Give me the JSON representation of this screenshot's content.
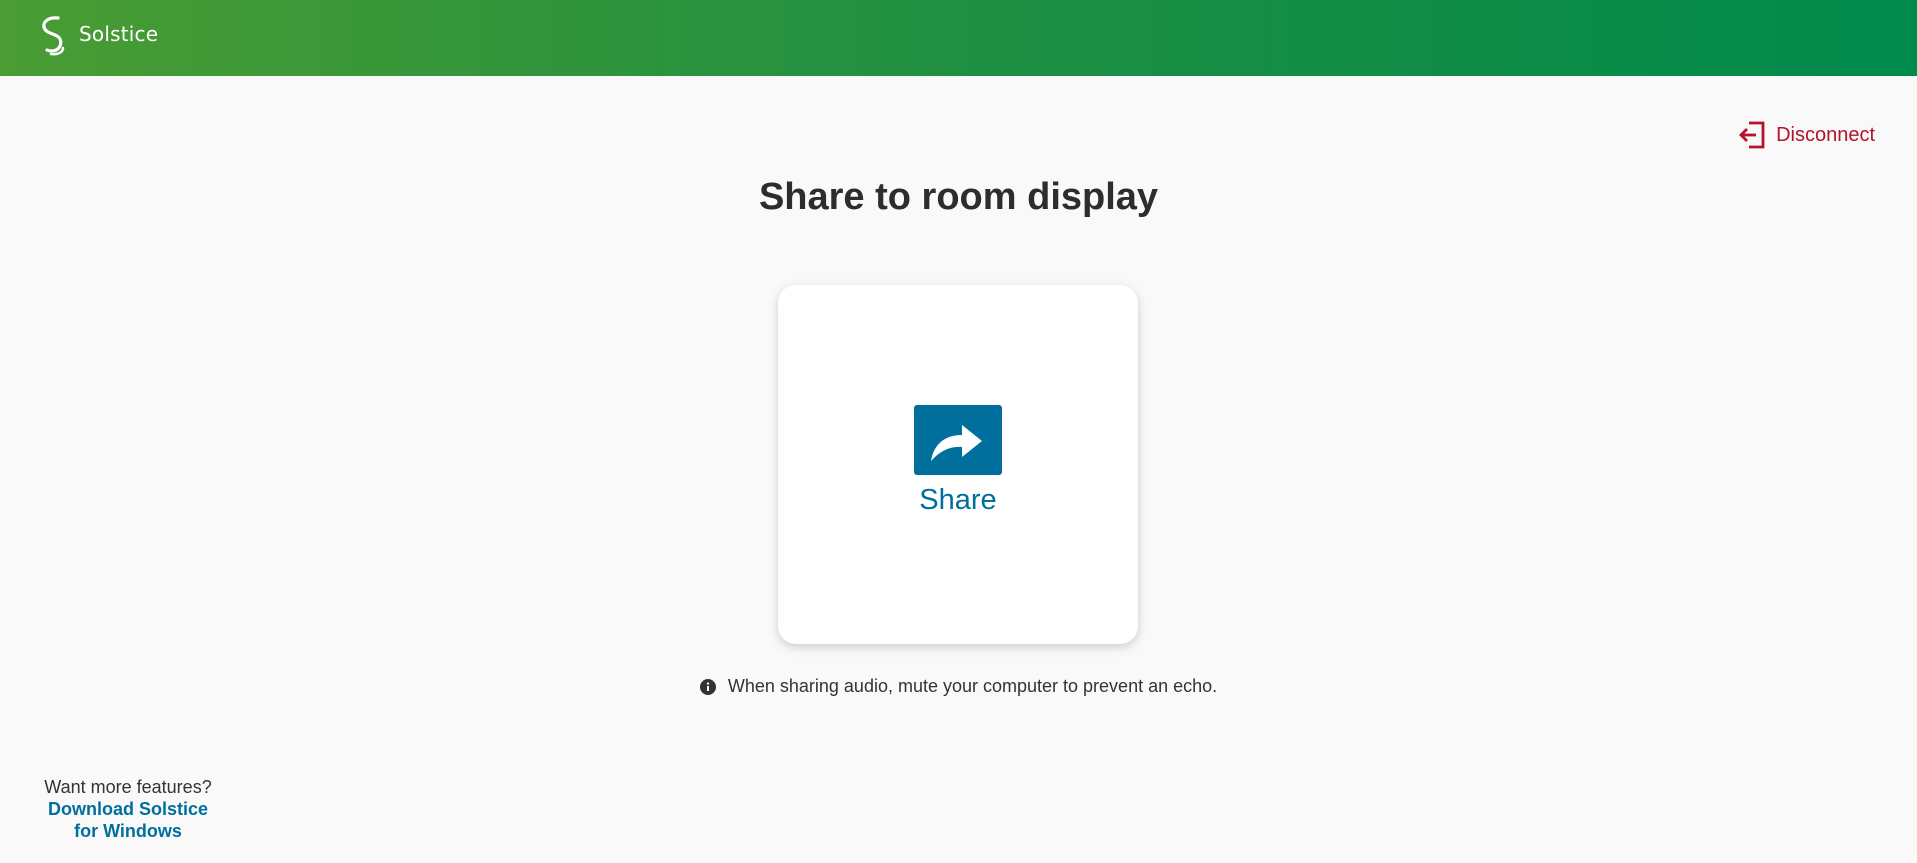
{
  "header": {
    "app_name": "Solstice",
    "logo_icon": "solstice-logo-icon"
  },
  "disconnect": {
    "label": "Disconnect",
    "icon": "sign-out-icon",
    "color": "#b3132b"
  },
  "main": {
    "title": "Share to room display",
    "share_card": {
      "label": "Share",
      "icon": "share-arrow-icon",
      "color": "#006f9e"
    },
    "info_text": "When sharing audio, mute your computer to prevent an echo.",
    "info_icon": "info-icon"
  },
  "promo": {
    "text": "Want more features?",
    "link_line1": "Download Solstice",
    "link_line2": "for Windows"
  },
  "colors": {
    "header_gradient_start": "#4a9c33",
    "header_gradient_end": "#008a4c",
    "background": "#f9f9f9"
  }
}
